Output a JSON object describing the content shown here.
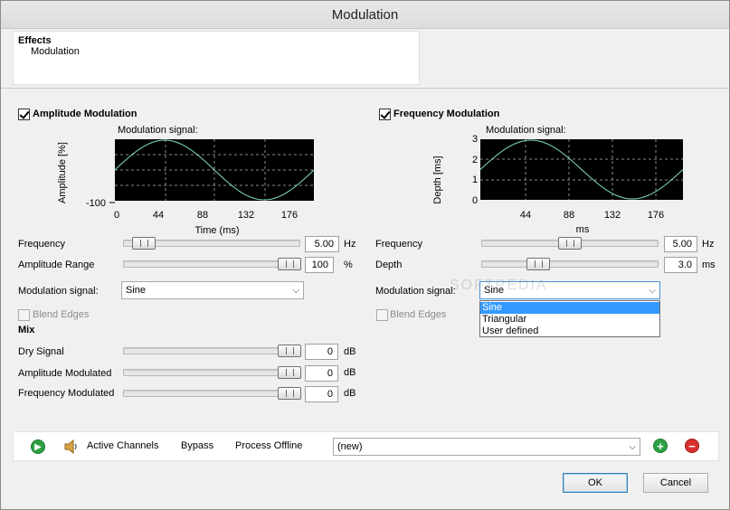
{
  "window": {
    "title": "Modulation"
  },
  "effects": {
    "heading": "Effects",
    "item": "Modulation"
  },
  "amplitude": {
    "checkbox_label": "Amplitude Modulation",
    "checked": true,
    "chart_title": "Modulation signal:",
    "ylabel": "Amplitude [%]",
    "ytick": "-100",
    "xticks": [
      "0",
      "44",
      "88",
      "132",
      "176"
    ],
    "xlabel": "Time (ms)",
    "frequency_label": "Frequency",
    "frequency_value": "5.00",
    "frequency_unit": "Hz",
    "range_label": "Amplitude Range",
    "range_value": "100",
    "range_unit": "%",
    "signal_label": "Modulation signal:",
    "signal_value": "Sine",
    "blend_label": "Blend Edges"
  },
  "frequency": {
    "checkbox_label": "Frequency Modulation",
    "checked": true,
    "chart_title": "Modulation signal:",
    "ylabel": "Depth [ms]",
    "yticks": [
      "3",
      "2",
      "1",
      "0"
    ],
    "xticks": [
      "44",
      "88",
      "132",
      "176"
    ],
    "xlabel": "ms",
    "frequency_label": "Frequency",
    "frequency_value": "5.00",
    "frequency_unit": "Hz",
    "depth_label": "Depth",
    "depth_value": "3.0",
    "depth_unit": "ms",
    "signal_label": "Modulation signal:",
    "signal_value": "Sine",
    "signal_options": [
      "Sine",
      "Triangular",
      "User defined"
    ],
    "blend_label": "Blend Edges"
  },
  "mix": {
    "heading": "Mix",
    "rows": [
      {
        "label": "Dry Signal",
        "value": "0",
        "unit": "dB"
      },
      {
        "label": "Amplitude Modulated",
        "value": "0",
        "unit": "dB"
      },
      {
        "label": "Frequency Modulated",
        "value": "0",
        "unit": "dB"
      }
    ]
  },
  "toolbar": {
    "play_icon": "play-icon",
    "speaker_icon": "speaker-icon",
    "active_channels": "Active Channels",
    "bypass": "Bypass",
    "process_offline": "Process Offline",
    "preset_value": "(new)",
    "add_icon": "add-preset-icon",
    "remove_icon": "remove-preset-icon"
  },
  "buttons": {
    "ok": "OK",
    "cancel": "Cancel"
  },
  "watermark": "SOFTPEDIA",
  "colors": {
    "plot_bg": "#000000",
    "sine": "#7fe0c0",
    "grid": "#8a8a8a",
    "selection": "#3399ff",
    "play": "#2ea043",
    "add": "#2ea043",
    "remove": "#d93030"
  }
}
